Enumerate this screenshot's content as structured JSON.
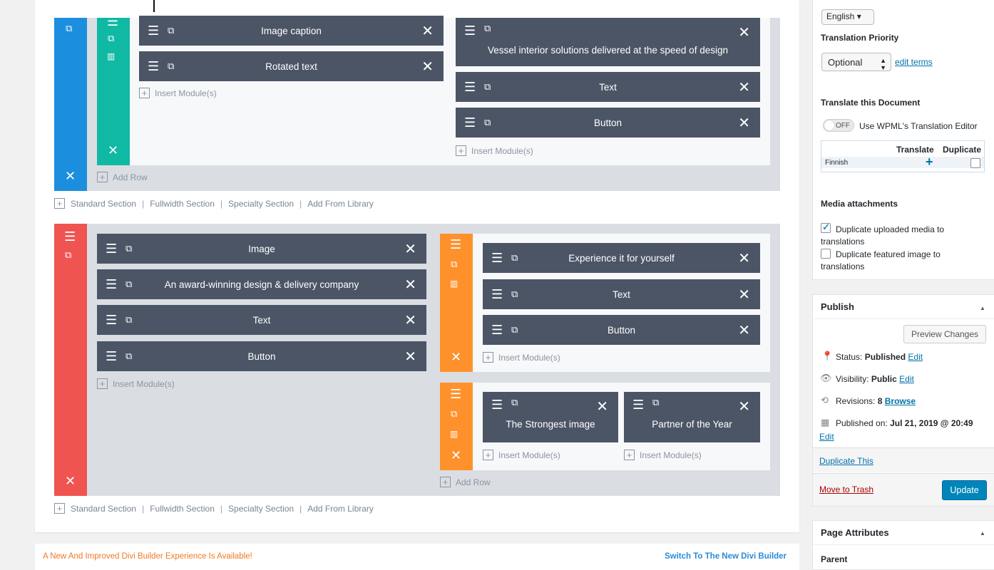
{
  "builder": {
    "section1": {
      "row1_modules": [
        "Image caption",
        "Rotated text"
      ],
      "row1_insert": "Insert Module(s)",
      "row2_modules": [
        "Vessel interior solutions delivered at the speed of design",
        "Text",
        "Button"
      ],
      "row2_insert": "Insert Module(s)",
      "add_row": "Add Row"
    },
    "section_links": [
      "Standard Section",
      "Fullwidth Section",
      "Specialty Section",
      "Add From Library"
    ],
    "section2": {
      "left_modules": [
        "Image",
        "An award-winning design & delivery company",
        "Text",
        "Button"
      ],
      "left_insert": "Insert Module(s)",
      "right_row1_modules": [
        "Experience it for yourself",
        "Text",
        "Button"
      ],
      "right_row1_insert": "Insert Module(s)",
      "right_row2_modules": [
        "The Strongest image",
        "Partner of the Year"
      ],
      "right_row2_inserts": [
        "Insert Module(s)",
        "Insert Module(s)"
      ],
      "add_row": "Add Row"
    },
    "notice_text": "A New And Improved Divi Builder Experience Is Available!",
    "notice_link": "Switch To The New Divi Builder"
  },
  "sidebar": {
    "language_value": "English",
    "translation_priority_label": "Translation Priority",
    "translation_priority_value": "Optional",
    "edit_terms": "edit terms",
    "translate_doc_label": "Translate this Document",
    "toggle_state": "OFF",
    "toggle_label": "Use WPML's Translation Editor",
    "table_headers": [
      "Translate",
      "Duplicate"
    ],
    "table_row_lang": "Finnish",
    "media_label": "Media attachments",
    "media_opt1": "Duplicate uploaded media to translations",
    "media_opt2": "Duplicate featured image to translations",
    "publish_title": "Publish",
    "preview_btn": "Preview Changes",
    "status_label": "Status:",
    "status_value": "Published",
    "visibility_label": "Visibility:",
    "visibility_value": "Public",
    "revisions_label": "Revisions:",
    "revisions_value": "8",
    "browse": "Browse",
    "published_on_label": "Published on:",
    "published_on_value": "Jul 21, 2019 @ 20:49",
    "edit": "Edit",
    "duplicate_this": "Duplicate This",
    "move_to_trash": "Move to Trash",
    "update_btn": "Update",
    "page_attributes_title": "Page Attributes",
    "parent_label": "Parent"
  },
  "colors": {
    "section_blue": "#1c8ede",
    "row_teal": "#10b9a4",
    "section_red": "#ef5451",
    "row_orange": "#fe912c",
    "module_bg": "#4c5566",
    "wp_blue": "#0085ba"
  }
}
